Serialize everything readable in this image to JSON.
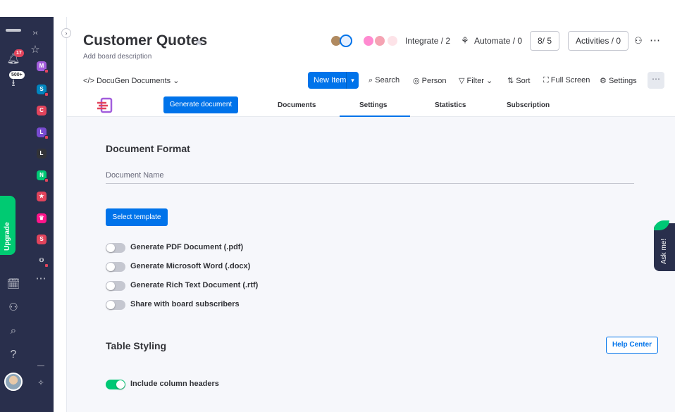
{
  "rail": {
    "notifications_badge": "17",
    "inbox_badge": "500+",
    "upgrade_label": "Upgrade",
    "workspaces": [
      {
        "letter": "M",
        "color": "#a25ddc"
      },
      {
        "letter": "S",
        "color": "#0086c0"
      },
      {
        "letter": "C",
        "color": "#e2445c"
      },
      {
        "letter": "L",
        "color": "#784bd1"
      },
      {
        "letter": "L",
        "color": "#323338"
      },
      {
        "letter": "N",
        "color": "#00c875"
      },
      {
        "letter": "",
        "color": "#e2445c"
      },
      {
        "letter": "",
        "color": "#ff158a"
      },
      {
        "letter": "S",
        "color": "#e2445c"
      },
      {
        "letter": "",
        "color": "#292f4c"
      }
    ]
  },
  "board": {
    "title": "Customer Quotes",
    "description": "Add board description",
    "integrate": "Integrate / 2",
    "automate": "Automate / 0",
    "members": "8/ 5",
    "activities": "Activities / 0",
    "view_label": "DocuGen Documents"
  },
  "toolbar": {
    "new_item": "New Item",
    "search": "Search",
    "person": "Person",
    "filter": "Filter",
    "sort": "Sort",
    "full_screen": "Full Screen",
    "settings": "Settings"
  },
  "app": {
    "generate_button": "Generate document",
    "tabs": [
      "Documents",
      "Settings",
      "Statistics",
      "Subscription"
    ],
    "active_tab": "Settings",
    "document_format_title": "Document Format",
    "document_name_placeholder": "Document Name",
    "select_template": "Select template",
    "toggles": [
      {
        "label": "Generate PDF Document (.pdf)",
        "on": false
      },
      {
        "label": "Generate Microsoft Word (.docx)",
        "on": false
      },
      {
        "label": "Generate Rich Text Document (.rtf)",
        "on": false
      },
      {
        "label": "Share with board subscribers",
        "on": false
      }
    ],
    "table_styling_title": "Table Styling",
    "help_center": "Help Center",
    "include_headers": {
      "label": "Include column headers",
      "on": true
    }
  },
  "ask_me": "Ask me!",
  "colors": {
    "primary": "#0073ea",
    "rail": "#292f4c",
    "upgrade": "#00ca72",
    "toggle_on": "#00c875",
    "toggle_off": "#c5c7d0"
  }
}
